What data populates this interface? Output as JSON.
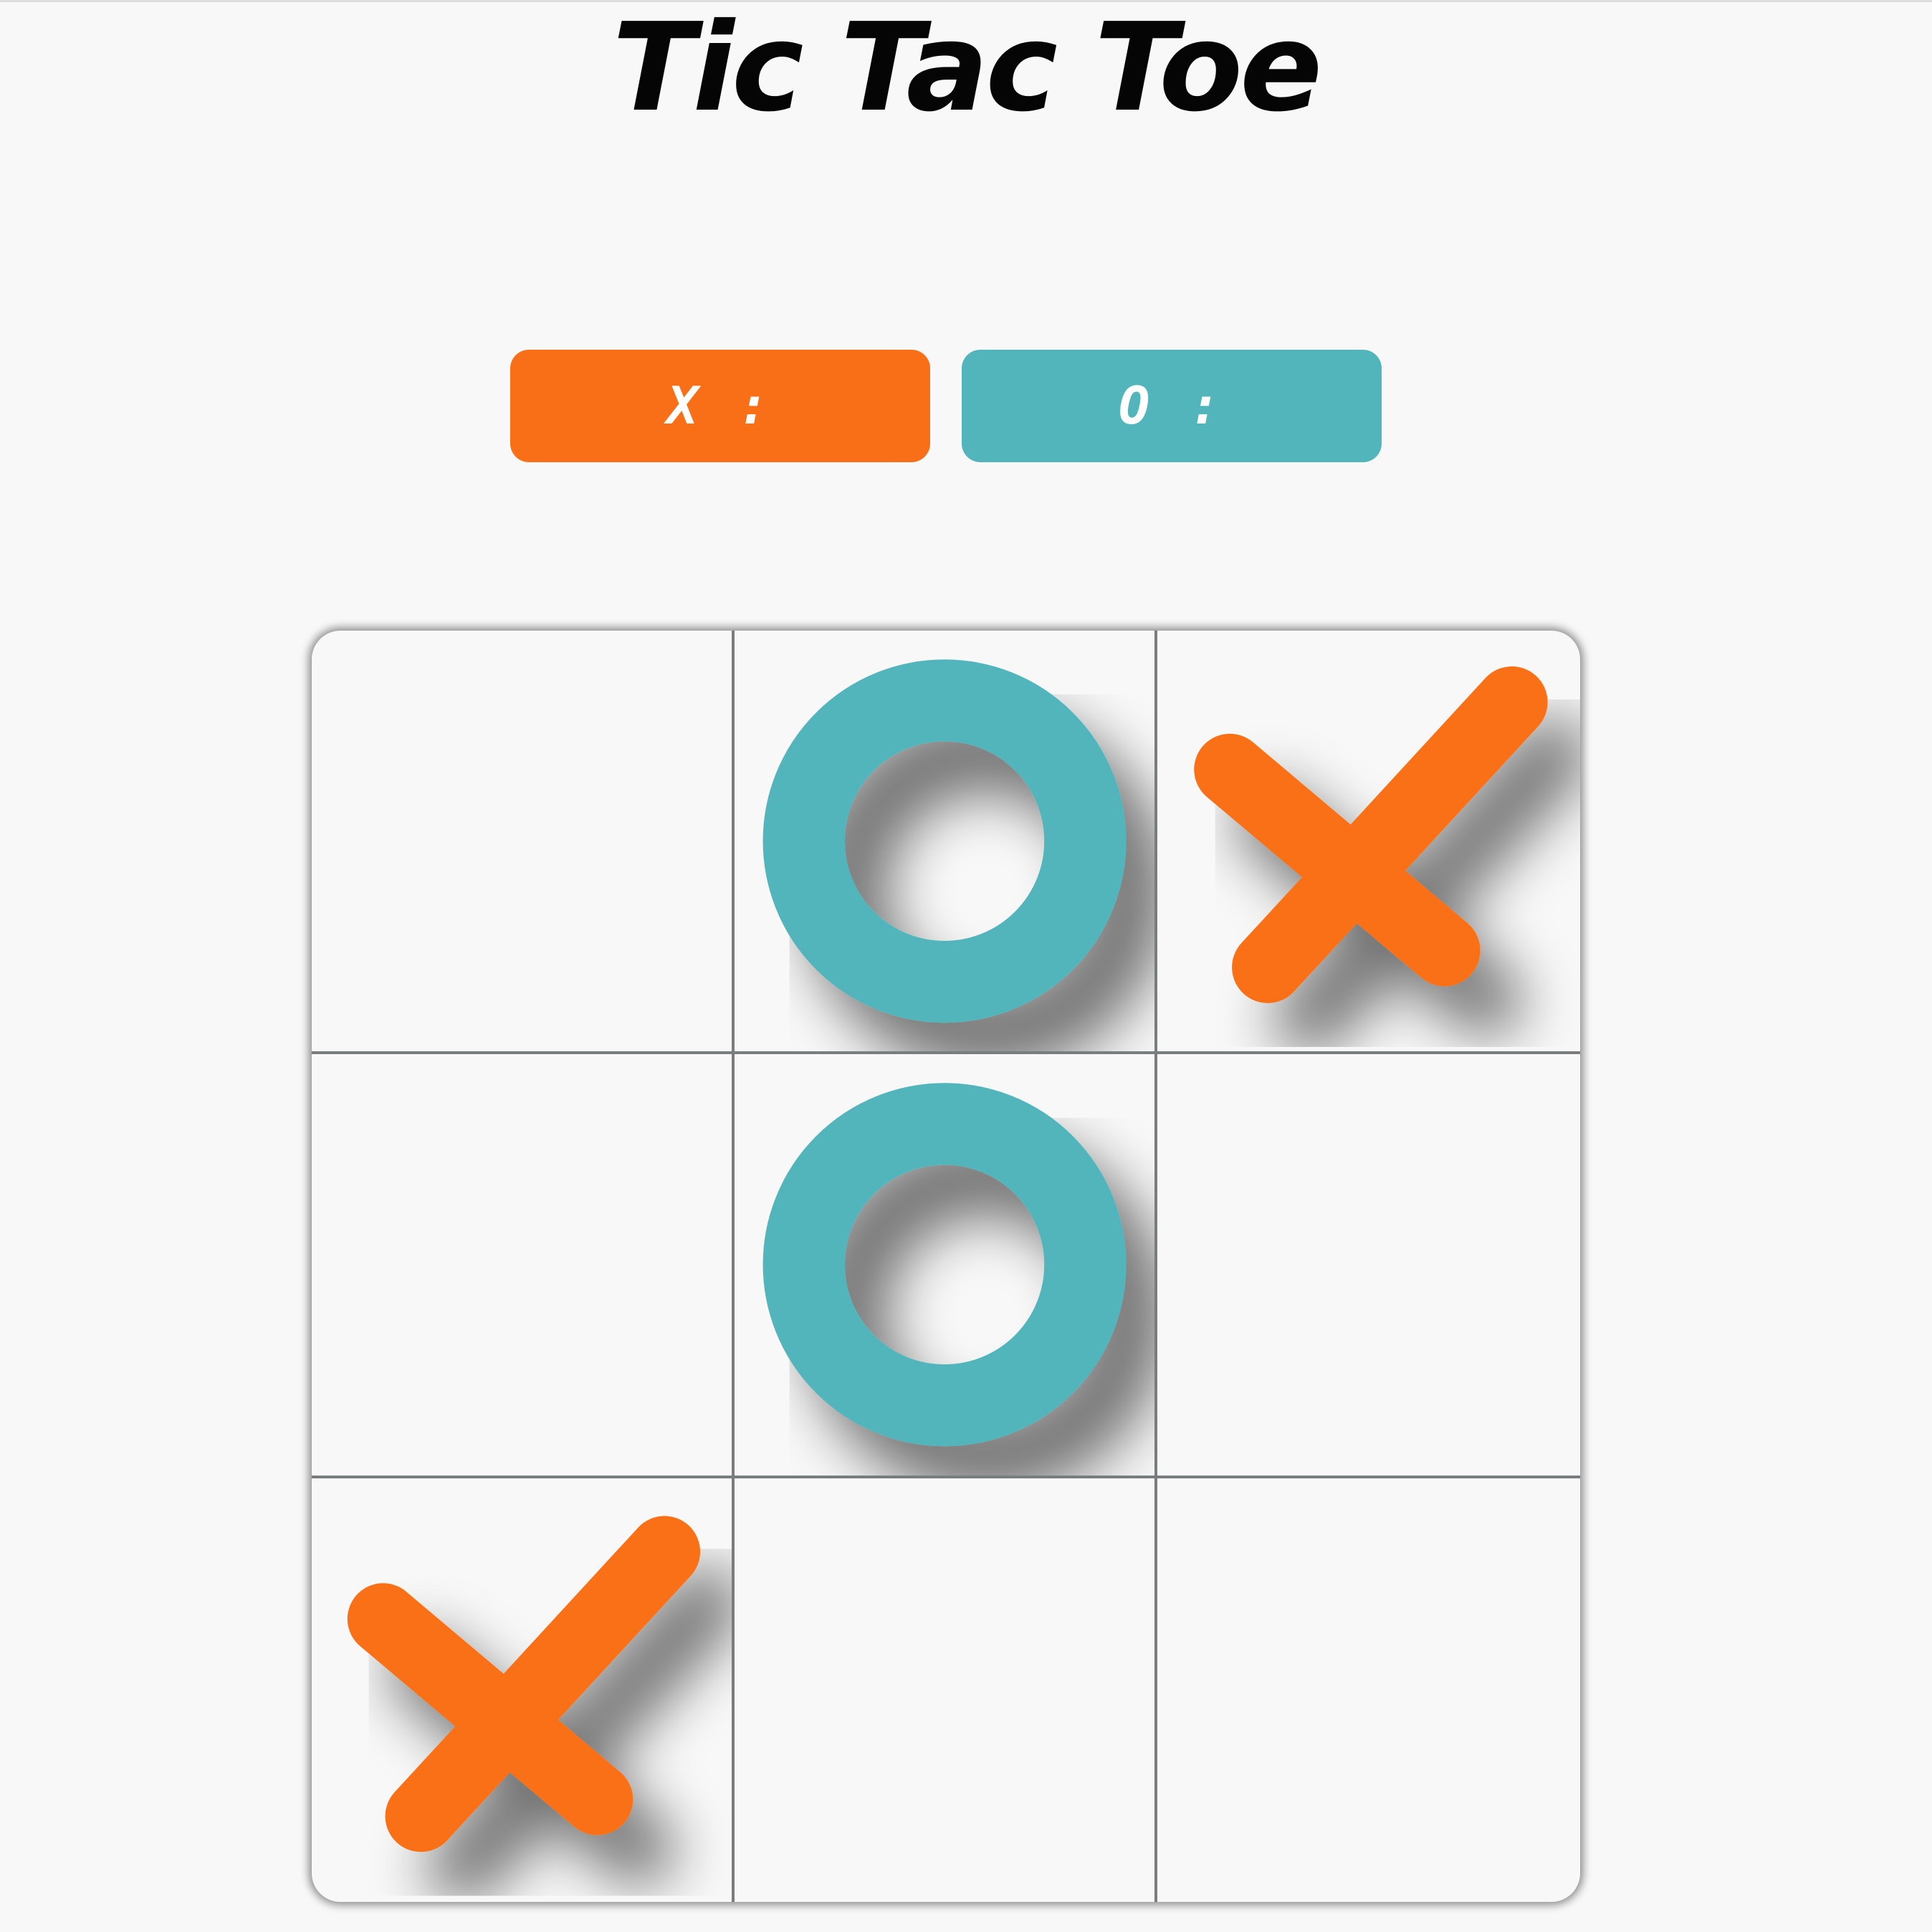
{
  "title": "Tic Tac Toe",
  "scores": {
    "x_label": "X :",
    "o_label": "O :"
  },
  "colors": {
    "x": "#f96f18",
    "o": "#52b5bc",
    "title": "#050505",
    "background": "#f8f8f8",
    "grid": "#7a7d7d"
  },
  "board": [
    [
      "",
      "O",
      "X"
    ],
    [
      "",
      "O",
      ""
    ],
    [
      "X",
      "",
      ""
    ]
  ],
  "icons": {
    "x": "x-mark-icon",
    "o": "o-mark-icon"
  }
}
